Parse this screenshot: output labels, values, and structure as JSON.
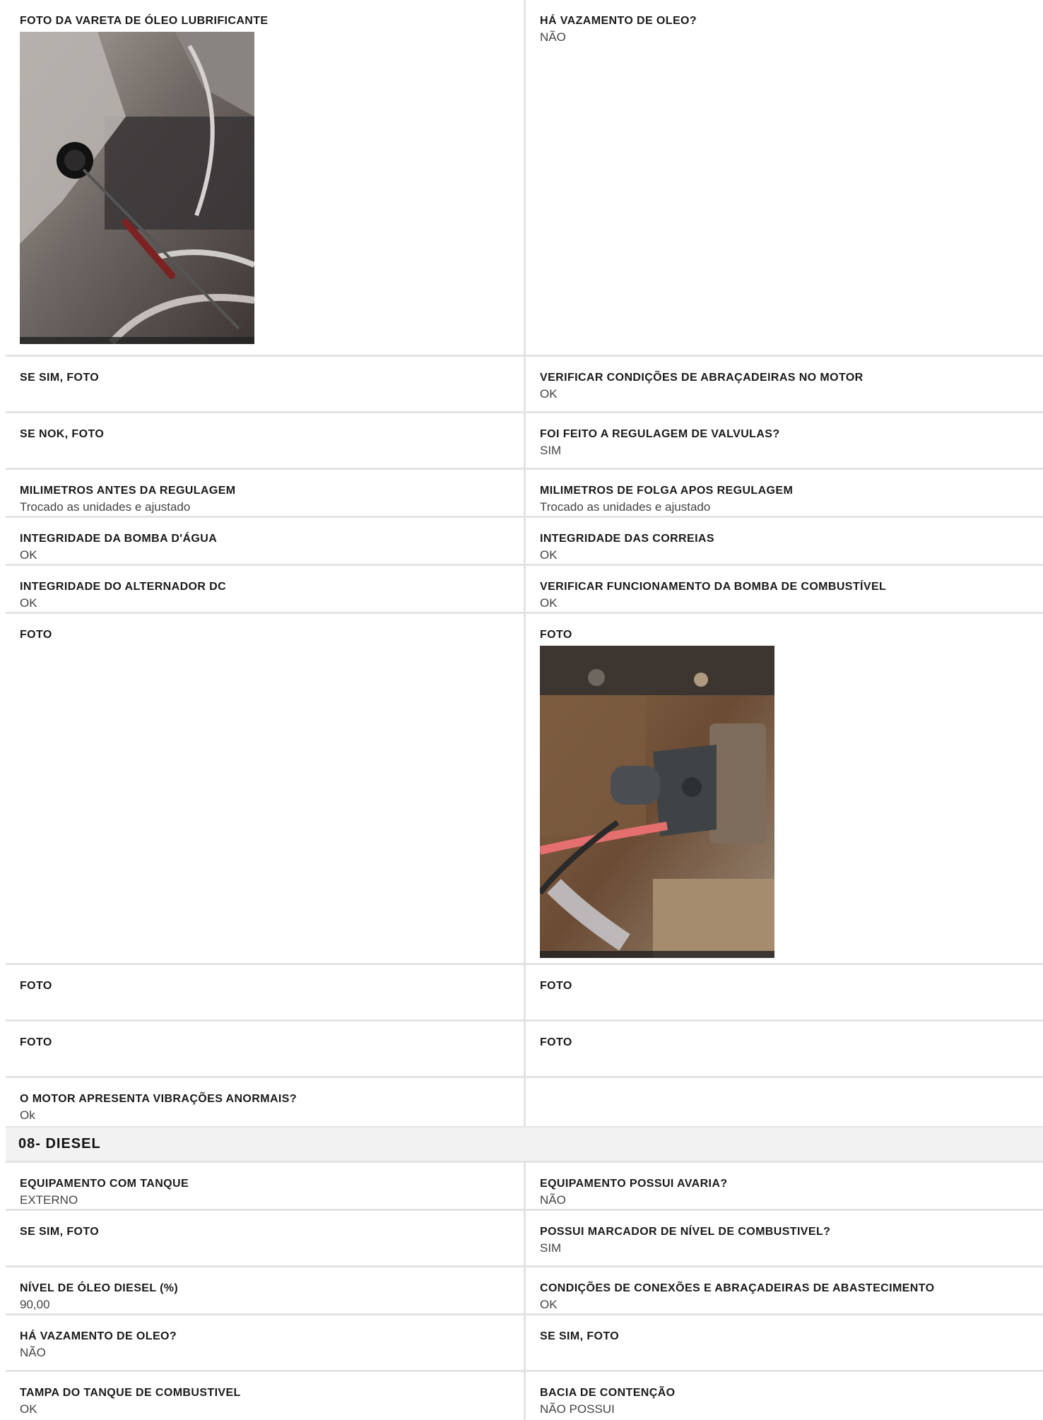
{
  "block1": {
    "rows": [
      {
        "left": {
          "label": "FOTO DA VARETA DE ÓLEO LUBRIFICANTE",
          "value": ""
        },
        "right": {
          "label": "HÁ VAZAMENTO DE OLEO?",
          "value": "NÃO"
        }
      },
      {
        "left": {
          "label": "SE SIM, FOTO",
          "value": ""
        },
        "right": {
          "label": "VERIFICAR CONDIÇÕES DE ABRAÇADEIRAS NO MOTOR",
          "value": "OK"
        }
      },
      {
        "left": {
          "label": "SE NOK, FOTO",
          "value": ""
        },
        "right": {
          "label": "FOI FEITO A REGULAGEM DE VALVULAS?",
          "value": "SIM"
        }
      },
      {
        "left": {
          "label": "MILIMETROS ANTES DA REGULAGEM",
          "value": "Trocado as unidades e ajustado"
        },
        "right": {
          "label": "MILIMETROS DE FOLGA APOS REGULAGEM",
          "value": "Trocado as unidades e ajustado"
        }
      },
      {
        "left": {
          "label": "INTEGRIDADE DA BOMBA D'ÁGUA",
          "value": "OK"
        },
        "right": {
          "label": "INTEGRIDADE DAS CORREIAS",
          "value": "OK"
        }
      },
      {
        "left": {
          "label": "INTEGRIDADE DO ALTERNADOR DC",
          "value": "OK"
        },
        "right": {
          "label": "VERIFICAR FUNCIONAMENTO DA BOMBA DE COMBUSTÍVEL",
          "value": "OK"
        }
      },
      {
        "left": {
          "label": "FOTO",
          "value": ""
        },
        "right": {
          "label": "FOTO",
          "value": ""
        }
      },
      {
        "left": {
          "label": "FOTO",
          "value": ""
        },
        "right": {
          "label": "FOTO",
          "value": ""
        }
      },
      {
        "left": {
          "label": "FOTO",
          "value": ""
        },
        "right": {
          "label": "FOTO",
          "value": ""
        }
      },
      {
        "left": {
          "label": "O MOTOR APRESENTA VIBRAÇÕES ANORMAIS?",
          "value": "Ok"
        },
        "right": {
          "label": "",
          "value": ""
        }
      }
    ]
  },
  "section": {
    "title": "08- DIESEL"
  },
  "block2": {
    "rows": [
      {
        "left": {
          "label": "EQUIPAMENTO COM TANQUE",
          "value": "EXTERNO"
        },
        "right": {
          "label": "EQUIPAMENTO POSSUI AVARIA?",
          "value": "NÃO"
        }
      },
      {
        "left": {
          "label": "SE SIM, FOTO",
          "value": ""
        },
        "right": {
          "label": "POSSUI MARCADOR DE NÍVEL DE COMBUSTIVEL?",
          "value": "SIM"
        }
      },
      {
        "left": {
          "label": "NÍVEL DE ÓLEO DIESEL (%)",
          "value": "90,00"
        },
        "right": {
          "label": "CONDIÇÕES DE CONEXÕES E ABRAÇADEIRAS DE ABASTECIMENTO",
          "value": "OK"
        }
      },
      {
        "left": {
          "label": "HÁ VAZAMENTO DE OLEO?",
          "value": "NÃO"
        },
        "right": {
          "label": "SE SIM, FOTO",
          "value": ""
        }
      },
      {
        "left": {
          "label": "TAMPA DO TANQUE DE COMBUSTIVEL",
          "value": "OK"
        },
        "right": {
          "label": "BACIA DE CONTENÇÃO",
          "value": "NÃO POSSUI"
        }
      }
    ]
  }
}
